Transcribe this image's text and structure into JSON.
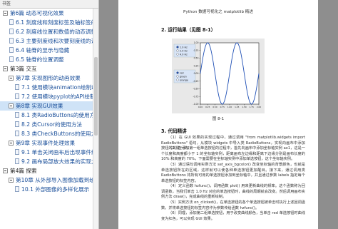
{
  "sidebar": {
    "header": "书签",
    "items": [
      {
        "label": "第6篇 动态可视化效果",
        "indent": 0,
        "kind": "chapter",
        "toggle": "minus"
      },
      {
        "label": "6.1 刻度线和刻度标签及轴标签的动态效果",
        "indent": 1,
        "kind": "doc"
      },
      {
        "label": "6.2 刻度线位置和数值的动态调整",
        "indent": 1,
        "kind": "doc"
      },
      {
        "label": "6.3 主要刻度线和次要刻度线的调整",
        "indent": 1,
        "kind": "doc"
      },
      {
        "label": "6.4 轴脊的显示与隐藏",
        "indent": 1,
        "kind": "doc"
      },
      {
        "label": "6.5 轴脊的位置调整",
        "indent": 1,
        "kind": "doc"
      },
      {
        "label": "第3篇 交互",
        "indent": 0,
        "kind": "part",
        "toggle": "minus"
      },
      {
        "label": "第7章 实现图形的动画效果",
        "indent": 1,
        "kind": "chapter",
        "toggle": "minus"
      },
      {
        "label": "7.1 使用模块animation绘制动画",
        "indent": 2,
        "kind": "doc"
      },
      {
        "label": "7.2 使用模块pyplot的API绘制动画",
        "indent": 2,
        "kind": "doc"
      },
      {
        "label": "第8章 实现GUI效果",
        "indent": 1,
        "kind": "chapter",
        "toggle": "minus",
        "selected": true
      },
      {
        "label": "8.1 类RadioButtons的使用方法",
        "indent": 2,
        "kind": "doc"
      },
      {
        "label": "8.2 类Cursor的使用方法",
        "indent": 2,
        "kind": "doc"
      },
      {
        "label": "8.3 类CheckButtons的使用方法",
        "indent": 2,
        "kind": "doc"
      },
      {
        "label": "第9章 实现事件处理效果",
        "indent": 1,
        "kind": "chapter",
        "toggle": "minus"
      },
      {
        "label": "9.1 单击关闭画布后出现事件结果提示",
        "indent": 2,
        "kind": "doc"
      },
      {
        "label": "9.2 画布局部放大效果的实现方法",
        "indent": 2,
        "kind": "doc"
      },
      {
        "label": "第4篇 探索",
        "indent": 0,
        "kind": "part",
        "toggle": "minus"
      },
      {
        "label": "第10章 从外部导入图像加载到绘图区域",
        "indent": 1,
        "kind": "chapter",
        "toggle": "minus"
      },
      {
        "label": "10.1 外部图像的多样化展示",
        "indent": 2,
        "kind": "doc"
      }
    ]
  },
  "page": {
    "header": "Python 数据可视化之 matplotlib 精进",
    "section1": "2. 运行结果（见图 8-1）",
    "figure_caption": "图 8-1",
    "section2": "3. 代码精讲",
    "legend_top": [
      "1.0 Hz",
      "2.0 Hz",
      "4.0 Hz"
    ],
    "legend_bottom": [
      "red",
      "green",
      "orange"
    ],
    "paragraphs": [
      "（1）在 GUI 效果的实现过程中，通过调用 \"from matplotlib.widgets import RadioButtons\" 语句，从模块 widgets 中导入类 RadioButtons，实现向画布中添加按钮的关键一步。",
      "（2）在添加第一组单选按钮的过程中，首先向画布中添加坐标轴实例 ax1，这是一个长度和高度都小于 1 的坐标轴实例，距离画布左边缘和距离下边缘分别是画布长度的 10% 和高度的 70%，下面需要在坐标轴实例中添加单选按钮，这个坐标轴实例。",
      "（3）通过语句调用实例方法 set_axis_bgcolor() 改变坐标轴的背景颜色，也就是单选按钮所在的区域，这样就可以使各种单选按钮更加醒目。接下来，通过调用类 RadioButtons 将所有可用的单选按钮添加到坐标轴中，并且通过参数 labels 指定每个单选按钮的标签内容。",
      "（4）定义函数 hzfunc()，调用函数 plot() 用来更新曲线的频率。这个函数称为回调函数，当我们单击 1.0 Hz 对应的单选按钮时，曲线的周期就会改变。然后调用画布实例方法 draw()，完成曲线的重新绘制。",
      "（5）实例方法 on_clicked()，在单选按钮的各个单选按钮被单击时执行上述回调函数，并将单选按钮的标签内容作为参数传给函数 hzfunc()。",
      "（6）同理，添加第二组单选按钮，用于改变曲线颜色，当单击 red 单选按钮时曲线变为红色，可以实现 GUI 效果。"
    ]
  },
  "chart_data": {
    "type": "line",
    "title": "",
    "xlabel": "",
    "ylabel": "",
    "x_tick_labels": [
      "0.00",
      "0.25",
      "0.50",
      "0.75",
      "1.00",
      "1.25",
      "1.50",
      "1.75",
      "2.00"
    ],
    "y_tick_labels": [
      "1.00",
      "0.75",
      "0.50",
      "0.25",
      "0.00",
      "-0.25",
      "-0.50",
      "-0.75",
      "-1.00"
    ],
    "xlim": [
      0,
      2
    ],
    "ylim": [
      -1,
      1
    ],
    "series": [
      {
        "name": "",
        "function": "sin(2*pi*f*t)",
        "frequency": 1.0,
        "color": "#1f4fb5"
      }
    ],
    "grid": false
  },
  "colors": {
    "selected_bg": "#cfe3f7",
    "link_text": "#1a4f9a",
    "line": "#1f4fb5",
    "radio_panel": "#d8e4f6"
  }
}
